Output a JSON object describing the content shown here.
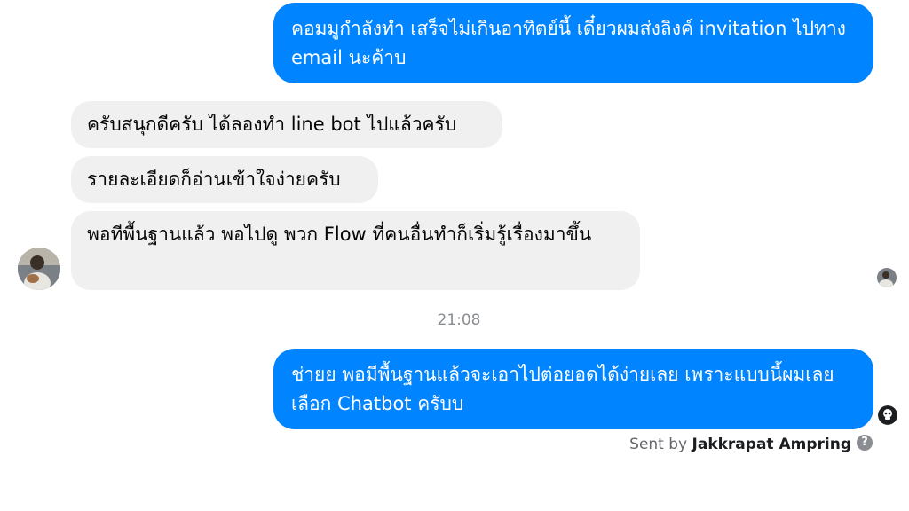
{
  "conversation": {
    "messages": [
      {
        "direction": "outgoing",
        "text": "คอมมูกำลังทำ เสร็จไม่เกินอาทิตย์นี้ เดี๋ยวผมส่งลิงค์ invitation ไปทาง email นะค้าบ"
      },
      {
        "direction": "incoming",
        "text": "ครับสนุกดีครับ ได้ลองทำ line bot ไปแล้วครับ"
      },
      {
        "direction": "incoming",
        "text": "รายละเอียดก็อ่านเข้าใจง่ายครับ"
      },
      {
        "direction": "incoming",
        "text": "พอทีพื้นฐานแล้ว พอไปดู พวก Flow ที่คนอื่นทำก็เริ่มรู้เรื่องมาขึ้น"
      },
      {
        "direction": "outgoing",
        "text": "ช่ายย พอมีพื้นฐานแล้วจะเอาไปต่อยอดได้ง่ายเลย เพราะแบบนี้ผมเลยเลือก Chatbot ครับบ"
      }
    ],
    "timestamp": "21:08",
    "sent_by_prefix": "Sent by",
    "sent_by_name": "Jakkrapat Ampring"
  },
  "icons": {
    "help": "help-circle-icon",
    "help_glyph": "?"
  },
  "colors": {
    "outgoing_bubble": "#0084ff",
    "incoming_bubble": "#f0f0f0",
    "timestamp_text": "#8a8d91"
  }
}
